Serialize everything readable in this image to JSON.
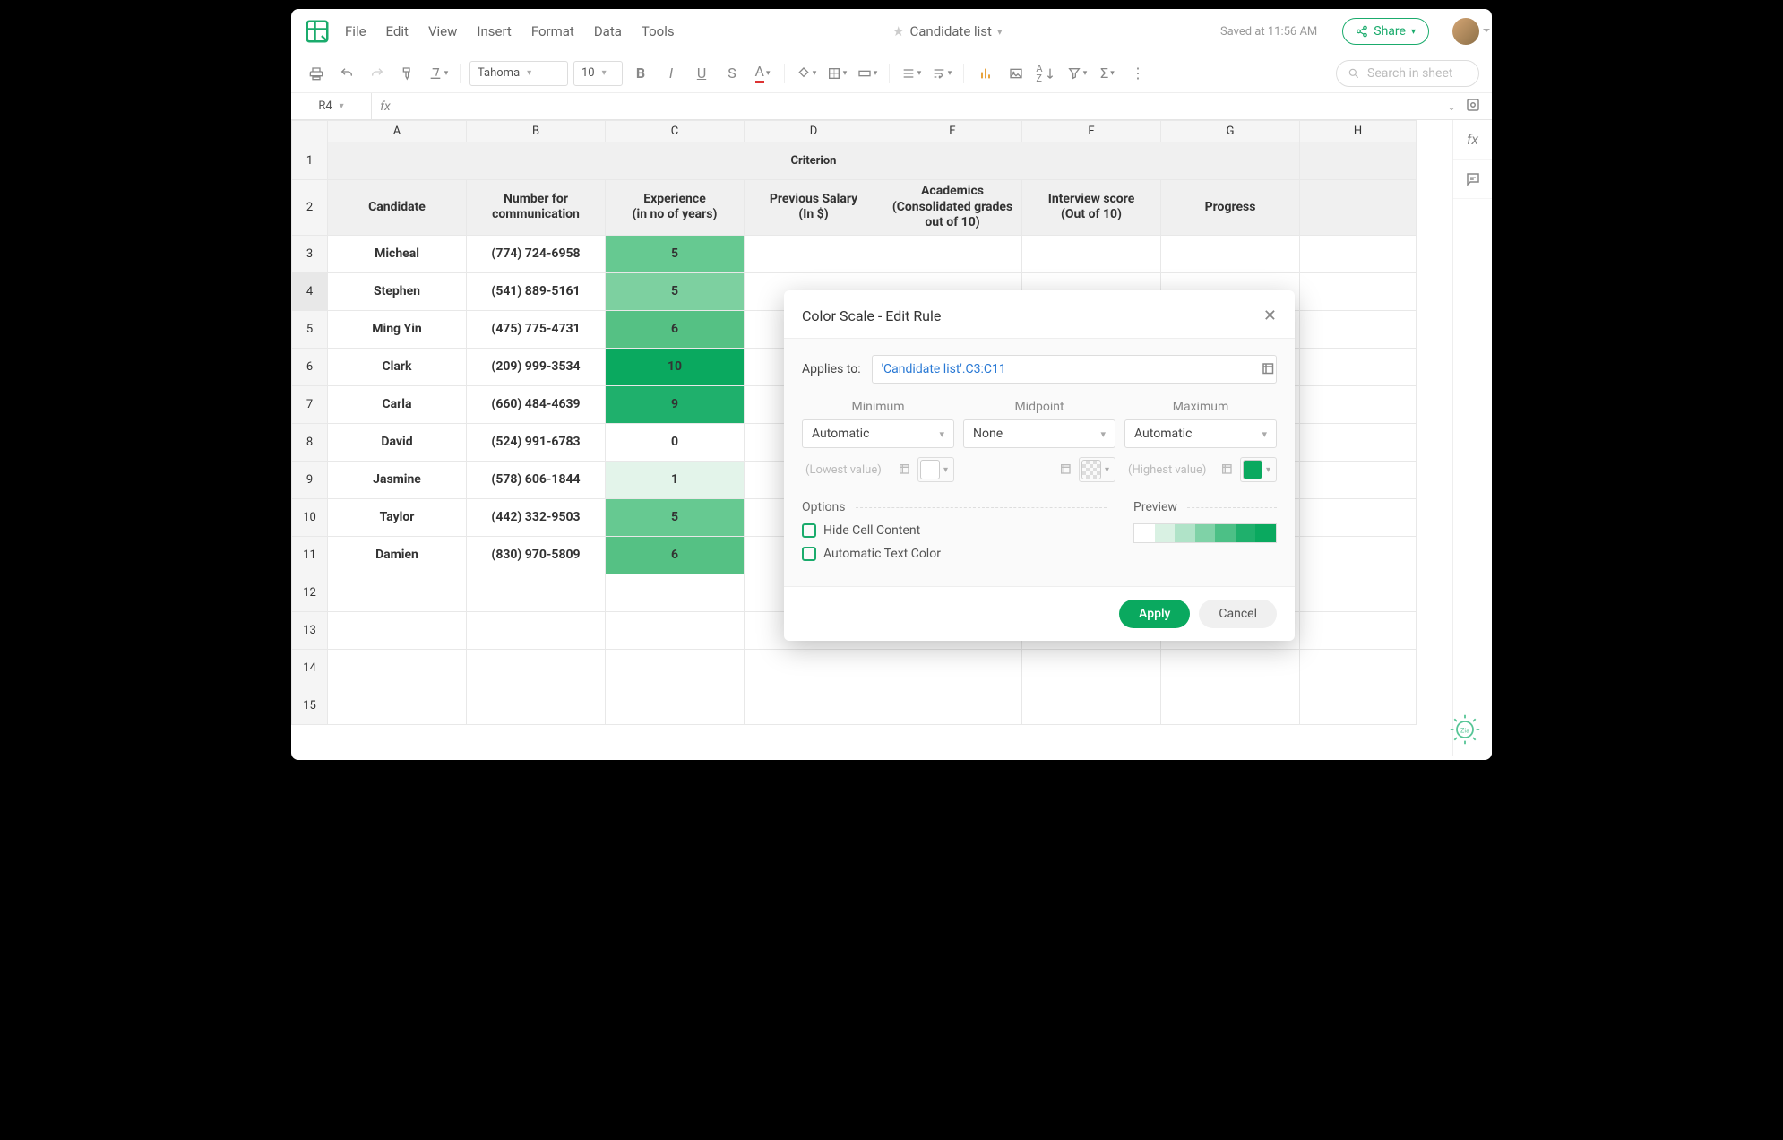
{
  "doc": {
    "name": "Candidate list",
    "saved": "Saved at 11:56 AM",
    "share": "Share"
  },
  "menu": [
    "File",
    "Edit",
    "View",
    "Insert",
    "Format",
    "Data",
    "Tools"
  ],
  "toolbar": {
    "font": "Tahoma",
    "size": "10",
    "search_ph": "Search in sheet"
  },
  "namebox": "R4",
  "columns": [
    "A",
    "B",
    "C",
    "D",
    "E",
    "F",
    "G",
    "H"
  ],
  "title": "Criterion",
  "headers": {
    "A": "Candidate",
    "B": "Number for communication",
    "C": "Experience (in no of years)",
    "D": "Previous Salary (In $)",
    "E": "Academics (Consolidated grades out of 10)",
    "F": "Interview score (Out of 10)",
    "G": "Progress"
  },
  "rows": [
    {
      "n": "3",
      "name": "Micheal",
      "num": "(774) 724-6958",
      "exp": "5",
      "color": "#66c991"
    },
    {
      "n": "4",
      "name": "Stephen",
      "num": "(541) 889-5161",
      "exp": "5",
      "color": "#7dd0a0",
      "sel": true
    },
    {
      "n": "5",
      "name": "Ming Yin",
      "num": "(475) 775-4731",
      "exp": "6",
      "color": "#55c184"
    },
    {
      "n": "6",
      "name": "Clark",
      "num": "(209) 999-3534",
      "exp": "10",
      "color": "#0aa95f"
    },
    {
      "n": "7",
      "name": "Carla",
      "num": "(660) 484-4639",
      "exp": "9",
      "color": "#1fb06c"
    },
    {
      "n": "8",
      "name": "David",
      "num": "(524) 991-6783",
      "exp": "0",
      "color": "#ffffff"
    },
    {
      "n": "9",
      "name": "Jasmine",
      "num": "(578) 606-1844",
      "exp": "1",
      "color": "#e3f4ea"
    },
    {
      "n": "10",
      "name": "Taylor",
      "num": "(442) 332-9503",
      "exp": "5",
      "color": "#66c991"
    },
    {
      "n": "11",
      "name": "Damien",
      "num": "(830) 970-5809",
      "exp": "6",
      "color": "#55c184"
    }
  ],
  "blankrows": [
    "12",
    "13",
    "14",
    "15"
  ],
  "dialog": {
    "title": "Color Scale - Edit Rule",
    "applies_label": "Applies to:",
    "applies_value": "'Candidate list'.C3:C11",
    "min": {
      "lbl": "Minimum",
      "mode": "Automatic",
      "ph": "(Lowest value)"
    },
    "mid": {
      "lbl": "Midpoint",
      "mode": "None"
    },
    "max": {
      "lbl": "Maximum",
      "mode": "Automatic",
      "ph": "(Highest value)"
    },
    "options_label": "Options",
    "opt1": "Hide Cell Content",
    "opt2": "Automatic Text Color",
    "preview_label": "Preview",
    "preview_colors": [
      "#ffffff",
      "#d9f1e3",
      "#b0e3c8",
      "#7fd2a7",
      "#4cc086",
      "#1fb06c",
      "#0aa95f"
    ],
    "apply": "Apply",
    "cancel": "Cancel"
  },
  "colwidths": {
    "A": 155,
    "B": 155,
    "C": 155,
    "D": 155,
    "E": 155,
    "F": 155,
    "G": 155,
    "H": 130
  }
}
